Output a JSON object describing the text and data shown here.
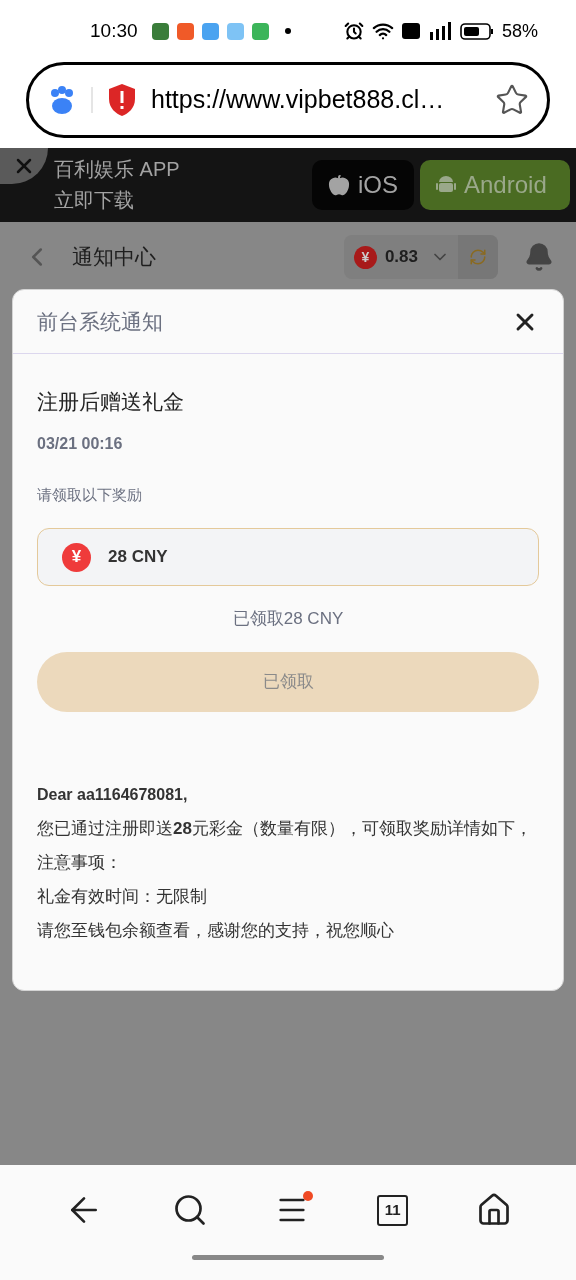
{
  "status_bar": {
    "time": "10:30",
    "battery": "58%"
  },
  "address_bar": {
    "url": "https://www.vipbet888.cl…"
  },
  "app_banner": {
    "title": "百利娱乐 APP",
    "subtitle": "立即下载",
    "buttons": [
      {
        "label": "iOS",
        "kind": "ios"
      },
      {
        "label": "Android",
        "kind": "android"
      }
    ]
  },
  "page_header": {
    "title": "通知中心",
    "currency_symbol": "¥",
    "balance": "0.83"
  },
  "dialog": {
    "title": "前台系统通知",
    "notice": {
      "title": "注册后赠送礼金",
      "date": "03/21 00:16",
      "prompt": "请领取以下奖励",
      "reward": {
        "symbol": "¥",
        "amount": "28 CNY"
      },
      "claimed_note": "已领取28 CNY",
      "claim_button": {
        "label": "已领取",
        "disabled": true
      },
      "greeting": "Dear aa1164678081,",
      "body": [
        "您已通过注册即送**28**元彩金（数量有限），可领取奖励详情如下，",
        "注意事项：",
        "礼金有效时间：无限制",
        "请您至钱包余额查看，感谢您的支持，祝您顺心"
      ]
    }
  },
  "bottom_nav": {
    "tab_count": "11",
    "menu_badge": true
  }
}
